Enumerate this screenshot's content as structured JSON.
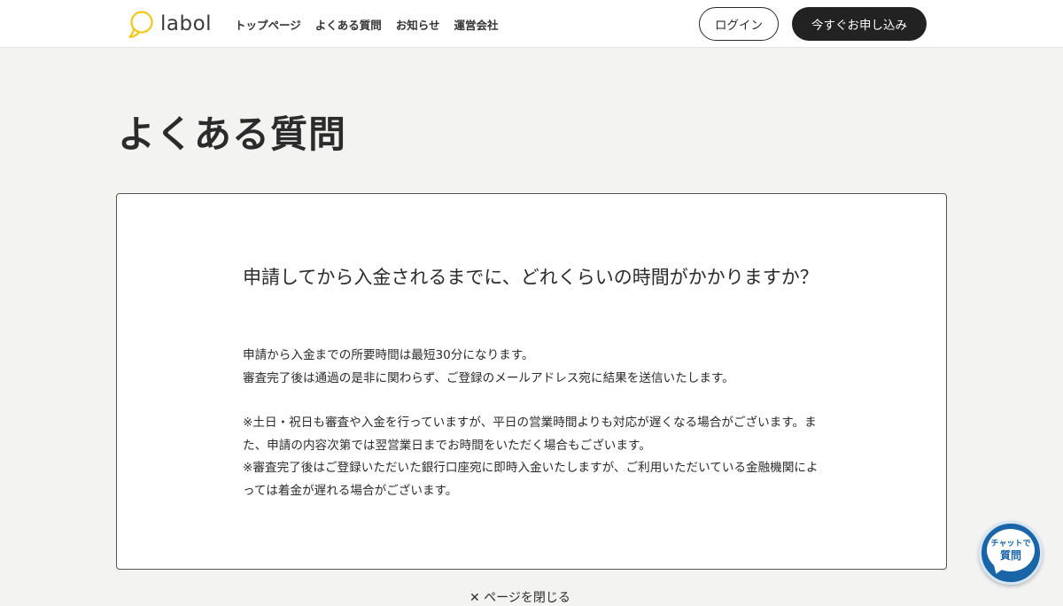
{
  "header": {
    "logo_text": "labol",
    "nav": [
      "トップページ",
      "よくある質問",
      "お知らせ",
      "運営会社"
    ],
    "login_label": "ログイン",
    "apply_label": "今すぐお申し込み"
  },
  "main": {
    "page_title": "よくある質問",
    "faq": {
      "question": "申請してから入金されるまでに、どれくらいの時間がかかりますか？",
      "answer_lines": [
        "申請から入金までの所要時間は最短30分になります。",
        "審査完了後は通過の是非に関わらず、ご登録のメールアドレス宛に結果を送信いたします。",
        "",
        "※土日・祝日も審査や入金を行っていますが、平日の営業時間よりも対応が遅くなる場合がございます。また、申請の内容次第では翌営業日までお時間をいただく場合もございます。",
        "※審査完了後はご登録いただいた銀行口座宛に即時入金いたしますが、ご利用いただいている金融機関によっては着金が遅れる場合がございます。"
      ]
    },
    "close_label": "✕ ページを閉じる"
  },
  "chat": {
    "line1": "チャットで",
    "line2": "質問"
  },
  "colors": {
    "logo_accent": "#f5c518",
    "chat_blue": "#1a65a8",
    "dark_button": "#222222"
  },
  "icons": {
    "logo": "speech-bubble-icon",
    "chat": "chat-bubble-icon"
  }
}
